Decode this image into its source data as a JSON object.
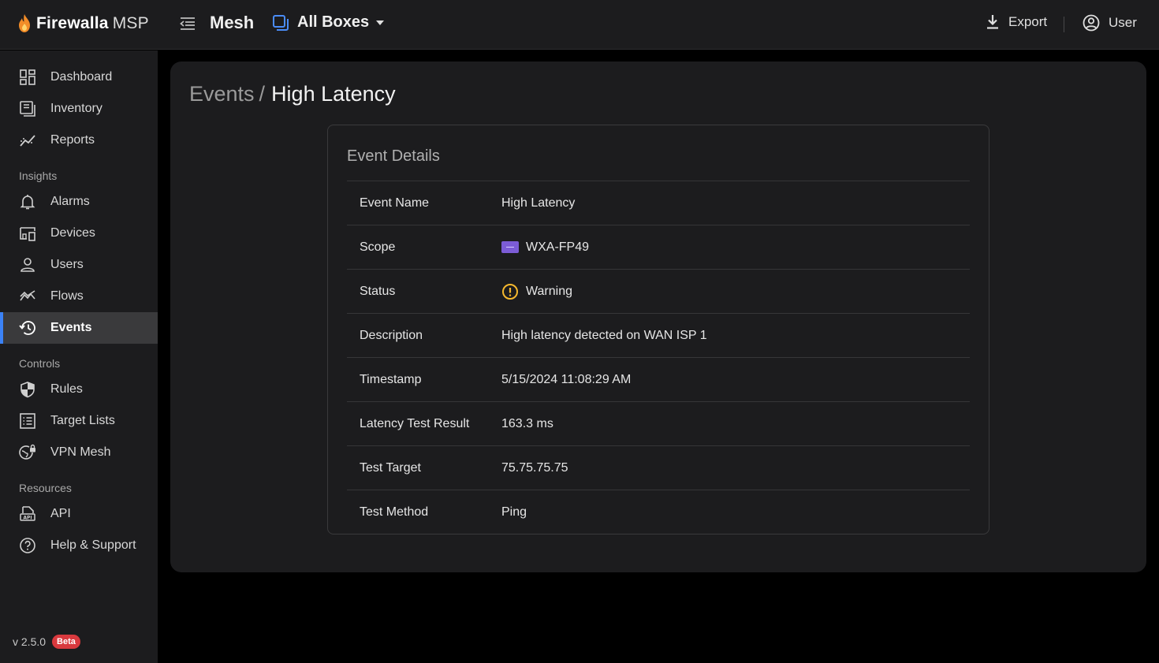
{
  "header": {
    "brand": "Firewalla",
    "brand_sub": "MSP",
    "app_title": "Mesh",
    "box_selector": "All Boxes",
    "export_label": "Export",
    "user_label": "User"
  },
  "sidebar": {
    "main_items": [
      {
        "label": "Dashboard",
        "icon": "dashboard-icon"
      },
      {
        "label": "Inventory",
        "icon": "inventory-icon"
      },
      {
        "label": "Reports",
        "icon": "reports-icon"
      }
    ],
    "sections": {
      "insights": "Insights",
      "controls": "Controls",
      "resources": "Resources"
    },
    "insights_items": [
      {
        "label": "Alarms",
        "icon": "bell-icon"
      },
      {
        "label": "Devices",
        "icon": "devices-icon"
      },
      {
        "label": "Users",
        "icon": "user-icon"
      },
      {
        "label": "Flows",
        "icon": "flows-icon"
      },
      {
        "label": "Events",
        "icon": "history-icon",
        "active": true
      }
    ],
    "controls_items": [
      {
        "label": "Rules",
        "icon": "shield-icon"
      },
      {
        "label": "Target Lists",
        "icon": "list-icon"
      },
      {
        "label": "VPN Mesh",
        "icon": "globe-lock-icon"
      }
    ],
    "resources_items": [
      {
        "label": "API",
        "icon": "api-doc-icon"
      },
      {
        "label": "Help & Support",
        "icon": "help-icon"
      }
    ],
    "version": "v 2.5.0",
    "version_badge": "Beta"
  },
  "breadcrumb": {
    "parent": "Events",
    "separator": "/",
    "current": "High Latency"
  },
  "card": {
    "title": "Event Details",
    "rows": [
      {
        "key": "Event Name",
        "value": "High Latency"
      },
      {
        "key": "Scope",
        "value": "WXA-FP49"
      },
      {
        "key": "Status",
        "value": "Warning"
      },
      {
        "key": "Description",
        "value": "High latency detected on WAN ISP 1"
      },
      {
        "key": "Timestamp",
        "value": "5/15/2024 11:08:29 AM"
      },
      {
        "key": "Latency Test Result",
        "value": "163.3 ms"
      },
      {
        "key": "Test Target",
        "value": "75.75.75.75"
      },
      {
        "key": "Test Method",
        "value": "Ping"
      }
    ]
  },
  "colors": {
    "accent": "#3b82f6",
    "warning": "#f5b82e",
    "scope_chip": "#7c5cd6",
    "beta_badge": "#d9393e"
  }
}
